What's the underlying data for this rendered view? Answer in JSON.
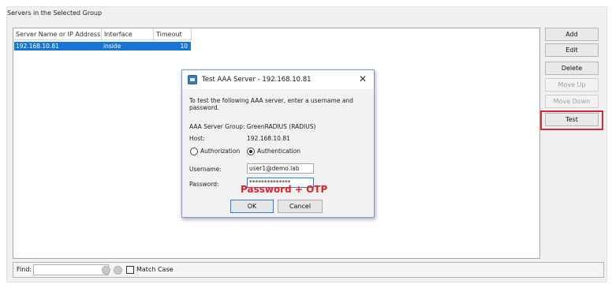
{
  "group": {
    "label": "Servers in the Selected Group"
  },
  "table": {
    "columns": [
      "Server Name or IP Address",
      "Interface",
      "Timeout"
    ],
    "rows": [
      {
        "server": "192.168.10.81",
        "interface": "inside",
        "timeout": "10"
      }
    ]
  },
  "side_buttons": {
    "add": "Add",
    "edit": "Edit",
    "delete": "Delete",
    "move_up": "Move Up",
    "move_down": "Move Down",
    "test": "Test"
  },
  "findbar": {
    "label": "Find:",
    "value": "",
    "match_case": "Match Case"
  },
  "dialog": {
    "title": "Test AAA Server - 192.168.10.81",
    "close": "✕",
    "intro_line1": "To test the following AAA server, enter a username and",
    "intro_line2": "password.",
    "group_line": "AAA Server Group:  GreenRADIUS (RADIUS)",
    "host_label": "Host:",
    "host_value": "192.168.10.81",
    "radio_authorization": "Authorization",
    "radio_authentication": "Authentication",
    "selected_radio": "Authentication",
    "username_label": "Username:",
    "username_value": "user1@demo.lab",
    "password_label": "Password:",
    "password_value": "**************",
    "annotation": "Password + OTP",
    "ok": "OK",
    "cancel": "Cancel"
  },
  "colors": {
    "selection": "#1776d4",
    "highlight": "#d92a32",
    "annotation": "#e0232b"
  }
}
